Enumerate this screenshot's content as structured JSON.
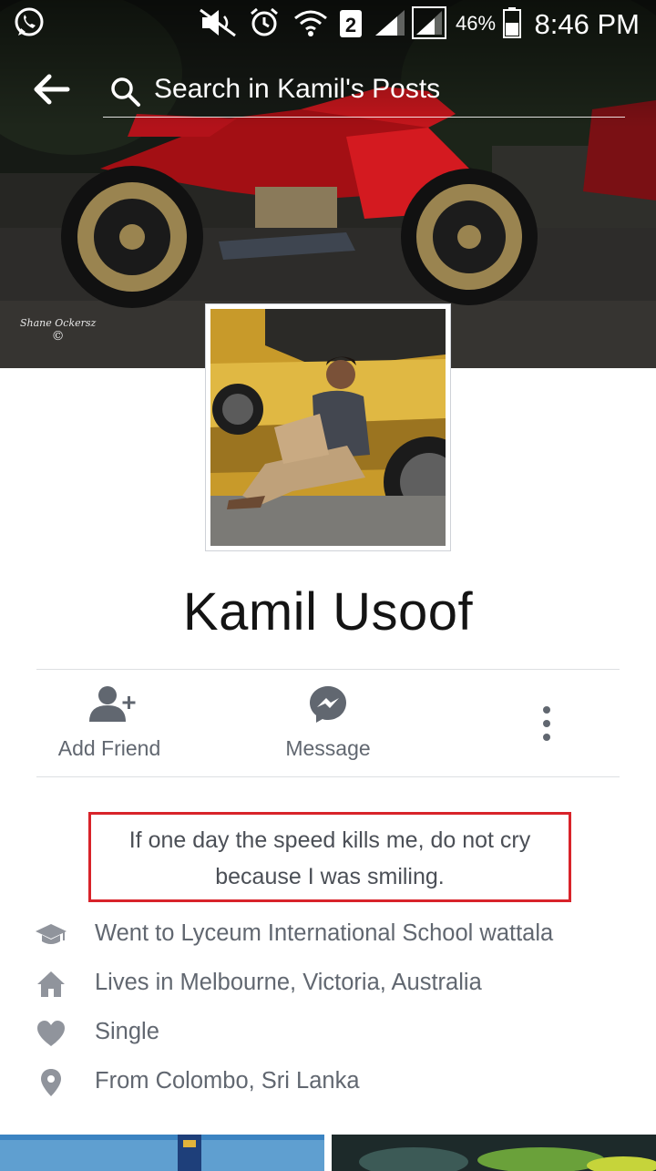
{
  "status_bar": {
    "battery_percent": "46%",
    "sim_slot": "2",
    "time": "8:46 PM",
    "icons": [
      "whatsapp-icon",
      "mute-icon",
      "alarm-icon",
      "wifi-icon",
      "sim-2-icon",
      "signal-icon",
      "battery-icon"
    ]
  },
  "header": {
    "search_placeholder": "Search in Kamil's Posts",
    "back_icon": "arrow-left-icon"
  },
  "cover": {
    "watermark_line1": "Shane Ockersz",
    "watermark_line2": "©"
  },
  "profile": {
    "name": "Kamil Usoof"
  },
  "actions": {
    "add_friend": "Add Friend",
    "message": "Message",
    "more_icon": "more-vertical-icon"
  },
  "bio": {
    "text": "If one day the speed kills me, do not cry because I was smiling."
  },
  "intro": [
    {
      "icon": "graduation-cap-icon",
      "text": "Went to Lyceum International School wattala"
    },
    {
      "icon": "home-icon",
      "text": "Lives in Melbourne, Victoria, Australia"
    },
    {
      "icon": "heart-icon",
      "text": "Single"
    },
    {
      "icon": "location-pin-icon",
      "text": "From Colombo, Sri Lanka"
    }
  ],
  "colors": {
    "accent_red": "#d8232a",
    "secondary_text": "#616770",
    "icon_gray": "#90949c"
  }
}
